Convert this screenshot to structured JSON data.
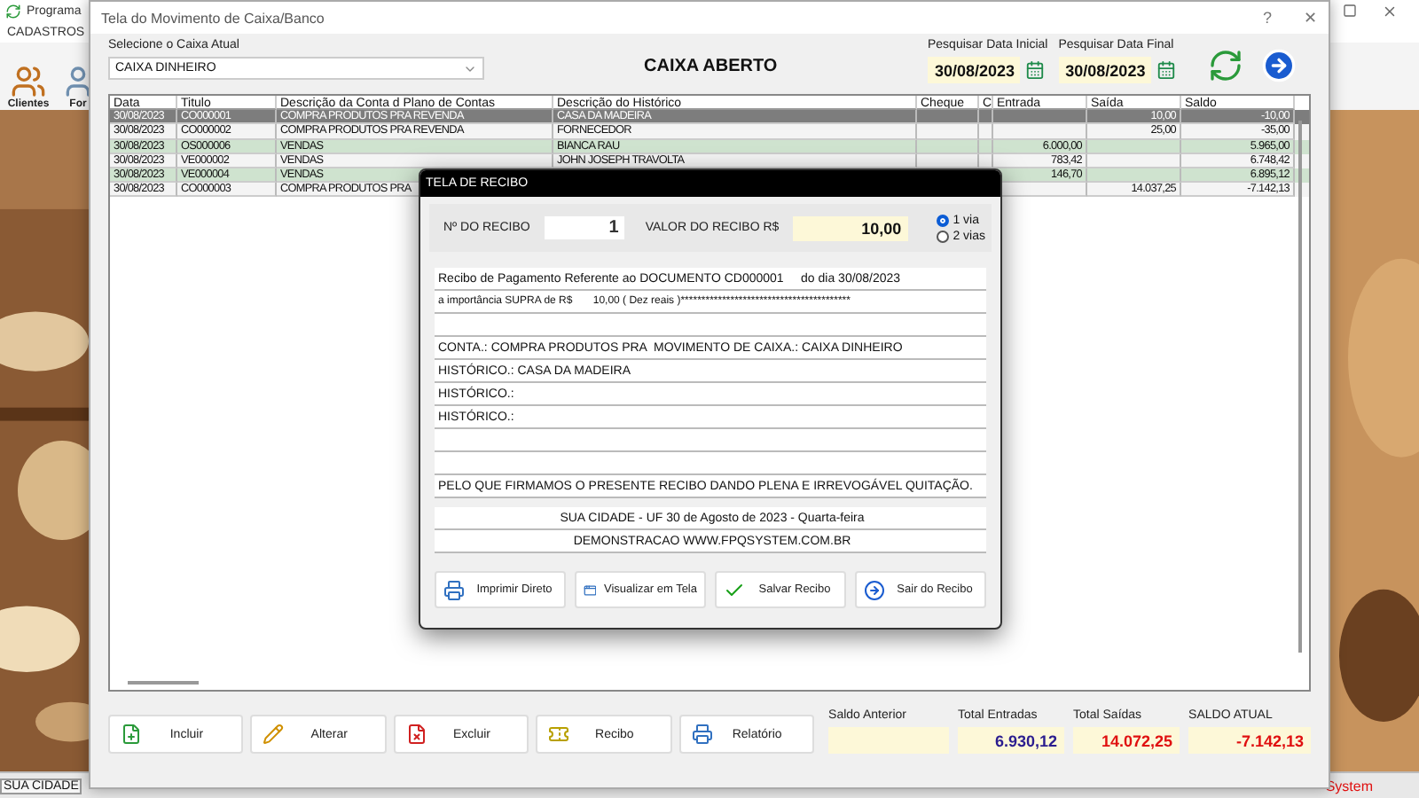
{
  "background_app": {
    "title": "Programa",
    "menu": [
      "CADASTROS"
    ],
    "toolbar": [
      {
        "label": "Clientes",
        "kind": "people"
      },
      {
        "label": "For",
        "kind": "person"
      }
    ],
    "status_left": "SUA CIDADE",
    "status_right": "System"
  },
  "window": {
    "title": "Tela do Movimento de Caixa/Banco",
    "help": "?",
    "close": "✕",
    "caixa_label": "Selecione o Caixa Atual",
    "caixa_value": "CAIXA DINHEIRO",
    "heading": "CAIXA ABERTO",
    "date_start": {
      "label": "Pesquisar Data Inicial",
      "value": "30/08/2023"
    },
    "date_end": {
      "label": "Pesquisar Data Final",
      "value": "30/08/2023"
    }
  },
  "table": {
    "columns": [
      "Data",
      "Titulo",
      "Descrição da Conta d Plano de Contas",
      "Descrição do Histórico",
      "Cheque",
      "C",
      "Entrada",
      "Saída",
      "Saldo"
    ],
    "rows": [
      {
        "selected": true,
        "date": "30/08/2023",
        "title": "CO000001",
        "account": "COMPRA PRODUTOS PRA REVENDA",
        "history": "CASA DA MADEIRA",
        "saida": "10,00",
        "saldo": "-10,00"
      },
      {
        "selected": false,
        "date": "30/08/2023",
        "title": "CO000002",
        "account": "COMPRA PRODUTOS PRA REVENDA",
        "history": "FORNECEDOR",
        "saida": "25,00",
        "saldo": "-35,00"
      },
      {
        "selected": false,
        "date": "30/08/2023",
        "title": "OS000006",
        "account": "VENDAS",
        "history": "BIANCA RAU",
        "entrada": "6.000,00",
        "saldo": "5.965,00"
      },
      {
        "selected": false,
        "date": "30/08/2023",
        "title": "VE000002",
        "account": "VENDAS",
        "history": "JOHN JOSEPH TRAVOLTA",
        "entrada": "783,42",
        "saldo": "6.748,42"
      },
      {
        "selected": false,
        "date": "30/08/2023",
        "title": "VE000004",
        "account": "VENDAS",
        "entrada": "146,70",
        "saldo": "6.895,12"
      },
      {
        "selected": false,
        "date": "30/08/2023",
        "title": "CO000003",
        "account": "COMPRA PRODUTOS PRA",
        "saida": "14.037,25",
        "saldo": "-7.142,13"
      }
    ]
  },
  "actions": [
    {
      "label": "Incluir",
      "kind": "add"
    },
    {
      "label": "Alterar",
      "kind": "edit"
    },
    {
      "label": "Excluir",
      "kind": "delete"
    },
    {
      "label": "Recibo",
      "kind": "receipt"
    },
    {
      "label": "Relatório",
      "kind": "report"
    }
  ],
  "totals": [
    {
      "label": "Saldo Anterior"
    },
    {
      "label": "Total Entradas",
      "value": "6.930,12",
      "color": "#2b1d8f"
    },
    {
      "label": "Total Saídas",
      "value": "14.072,25",
      "color": "#e01010"
    },
    {
      "label": "SALDO ATUAL",
      "value": "-7.142,13",
      "color": "#e01010"
    }
  ],
  "receipt_dialog": {
    "title": "TELA DE RECIBO",
    "number_label": "Nº DO RECIBO",
    "number": "1",
    "value_label": "VALOR DO RECIBO R$",
    "value": "10,00",
    "copies": [
      {
        "label": "1 via",
        "selected": true
      },
      {
        "label": "2 vias",
        "selected": false
      }
    ],
    "lines": [
      {
        "kind": "text",
        "text": "Recibo de Pagamento Referente ao DOCUMENTO CD000001     do dia 30/08/2023"
      },
      {
        "kind": "small",
        "text": "a importância SUPRA de R$       10,00 ( Dez reais )*****************************************"
      },
      {
        "kind": "blank"
      },
      {
        "kind": "text",
        "text": "CONTA.: COMPRA PRODUTOS PRA  MOVIMENTO DE CAIXA.: CAIXA DINHEIRO"
      },
      {
        "kind": "text",
        "text": "HISTÓRICO.: CASA DA MADEIRA"
      },
      {
        "kind": "text",
        "text": "HISTÓRICO.:"
      },
      {
        "kind": "text",
        "text": "HISTÓRICO.:"
      },
      {
        "kind": "blank"
      },
      {
        "kind": "blank"
      },
      {
        "kind": "text",
        "text": "PELO QUE FIRMAMOS O PRESENTE RECIBO DANDO PLENA E IRREVOGÁVEL QUITAÇÃO."
      },
      {
        "kind": "gap"
      },
      {
        "kind": "center",
        "text": "SUA CIDADE - UF 30 de Agosto de 2023 - Quarta-feira"
      },
      {
        "kind": "center",
        "text": "DEMONSTRACAO WWW.FPQSYSTEM.COM.BR"
      }
    ],
    "buttons": [
      {
        "label": "Imprimir Direto",
        "kind": "print"
      },
      {
        "label": "Visualizar em Tela",
        "kind": "preview"
      },
      {
        "label": "Salvar Recibo",
        "kind": "save"
      },
      {
        "label": "Sair do Recibo",
        "kind": "exit"
      }
    ]
  }
}
